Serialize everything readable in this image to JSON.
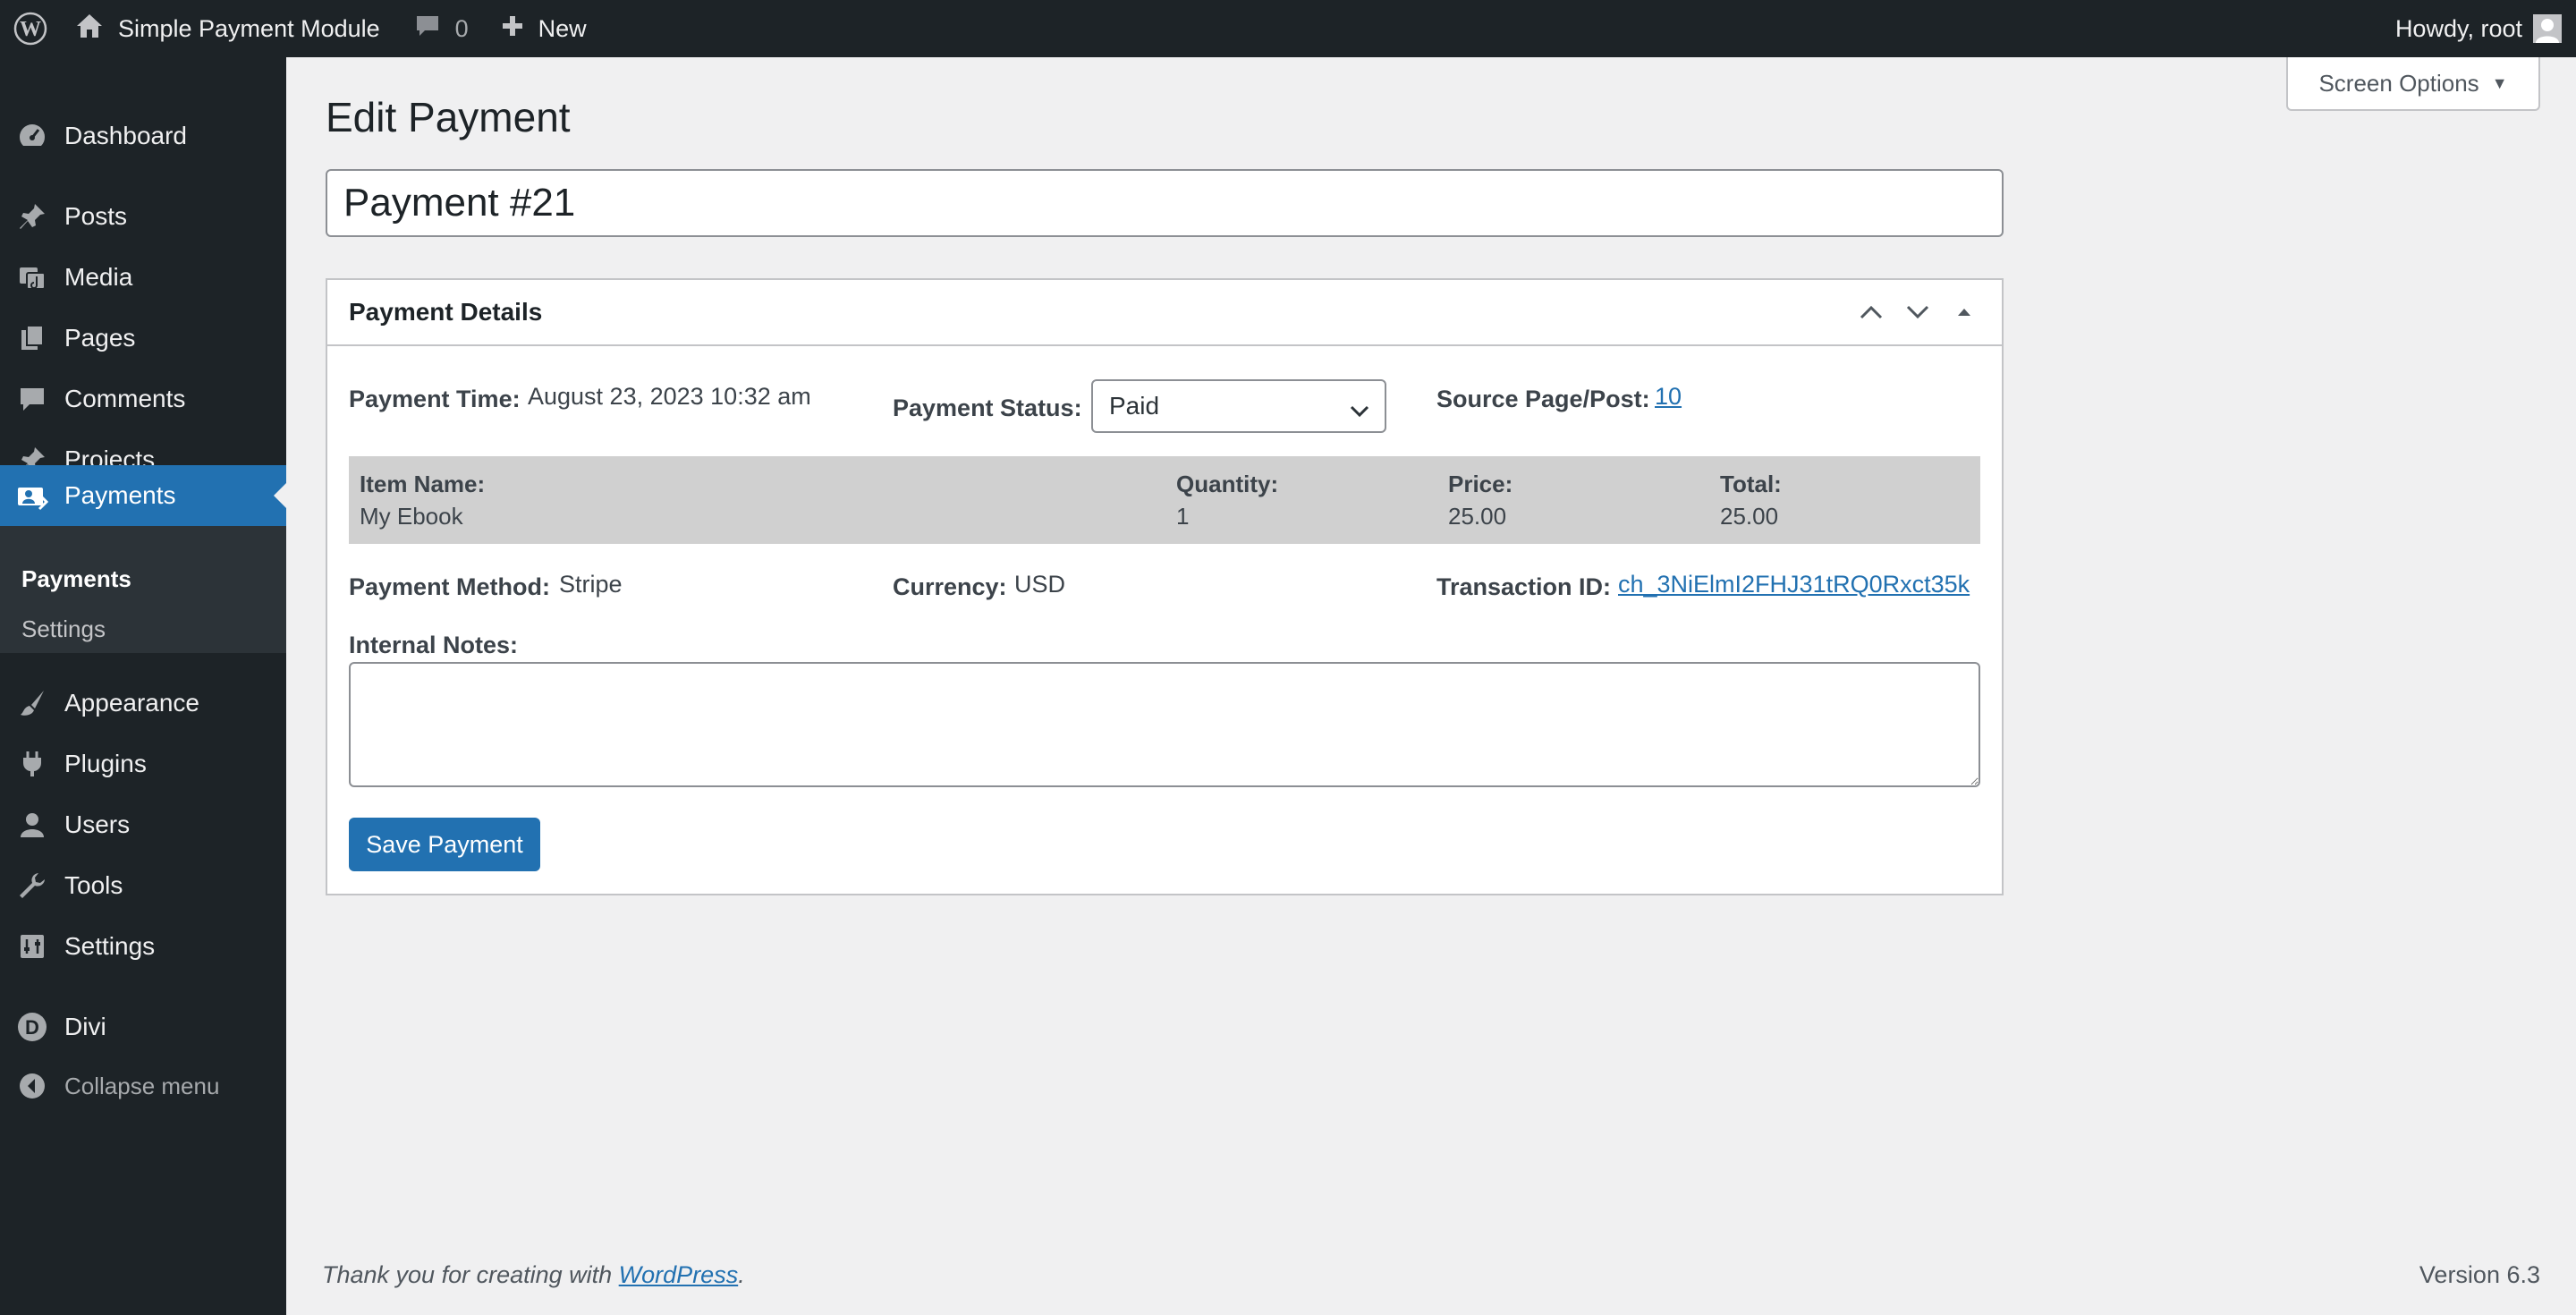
{
  "admin_bar": {
    "site_name": "Simple Payment Module",
    "comments_count": "0",
    "new_label": "New",
    "howdy": "Howdy, root"
  },
  "sidebar": {
    "items": [
      {
        "label": "Dashboard",
        "icon": "dashboard-icon"
      },
      {
        "label": "Posts",
        "icon": "pin-icon"
      },
      {
        "label": "Media",
        "icon": "media-icon"
      },
      {
        "label": "Pages",
        "icon": "pages-icon"
      },
      {
        "label": "Comments",
        "icon": "comment-icon"
      },
      {
        "label": "Projects",
        "icon": "pin-icon"
      },
      {
        "label": "Payments",
        "icon": "payments-icon"
      },
      {
        "label": "Appearance",
        "icon": "brush-icon"
      },
      {
        "label": "Plugins",
        "icon": "plug-icon"
      },
      {
        "label": "Users",
        "icon": "user-icon"
      },
      {
        "label": "Tools",
        "icon": "wrench-icon"
      },
      {
        "label": "Settings",
        "icon": "settings-icon"
      },
      {
        "label": "Divi",
        "icon": "divi-icon"
      },
      {
        "label": "Collapse menu",
        "icon": "collapse-icon"
      }
    ],
    "submenu": [
      "Payments",
      "Settings"
    ]
  },
  "screen_options": "Screen Options",
  "page": {
    "title": "Edit Payment",
    "post_title": "Payment #21"
  },
  "metabox": {
    "title": "Payment Details",
    "payment_time_label": "Payment Time:",
    "payment_time_value": "August 23, 2023 10:32 am",
    "payment_status_label": "Payment Status:",
    "payment_status_value": "Paid",
    "source_label": "Source Page/Post:",
    "source_value": "10",
    "items_table": {
      "headers": [
        "Item Name:",
        "Quantity:",
        "Price:",
        "Total:"
      ],
      "row": [
        "My Ebook",
        "1",
        "25.00",
        "25.00"
      ]
    },
    "payment_method_label": "Payment Method:",
    "payment_method_value": "Stripe",
    "currency_label": "Currency:",
    "currency_value": "USD",
    "transaction_label": "Transaction ID:",
    "transaction_value": "ch_3NiElmI2FHJ31tRQ0Rxct35k",
    "notes_label": "Internal Notes:",
    "notes_value": "",
    "save_label": "Save Payment"
  },
  "footer": {
    "thanks_prefix": "Thank you for creating with ",
    "wordpress_link": "WordPress",
    "thanks_suffix": ".",
    "version": "Version 6.3"
  },
  "colors": {
    "admin_dark": "#1d2327",
    "accent": "#2271b1",
    "background": "#f0f0f1"
  }
}
